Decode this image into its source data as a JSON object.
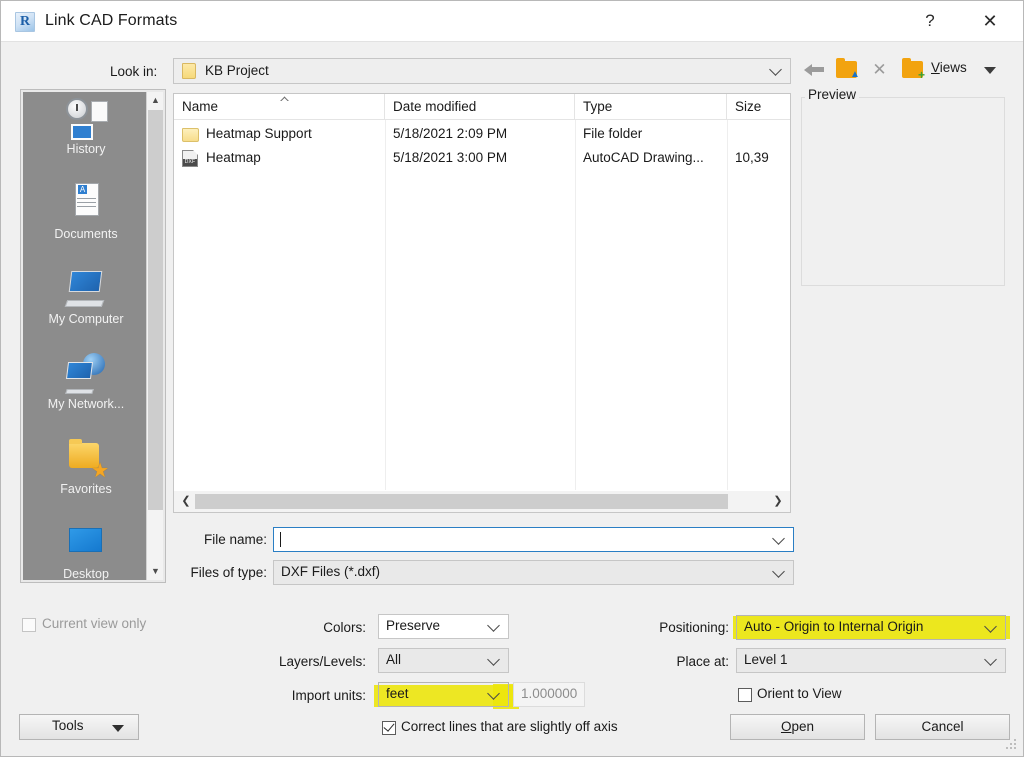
{
  "window": {
    "title": "Link CAD Formats",
    "app_icon": "revit-r-icon",
    "help_label": "?",
    "close_label": "✕"
  },
  "navigation": {
    "look_in_label": "Look in:",
    "look_in_value": "KB Project",
    "toolbar": {
      "back_icon": "back-arrow-icon",
      "up_folder_icon": "up-one-level-folder-icon",
      "delete_icon": "delete-x-icon",
      "new_folder_icon": "new-folder-icon",
      "views_label": "Views",
      "views_accel": "V"
    }
  },
  "places": [
    {
      "label": "History",
      "icon": "history-icon"
    },
    {
      "label": "Documents",
      "icon": "documents-icon"
    },
    {
      "label": "My Computer",
      "icon": "my-computer-icon"
    },
    {
      "label": "My Network...",
      "icon": "my-network-icon"
    },
    {
      "label": "Favorites",
      "icon": "favorites-icon"
    },
    {
      "label": "Desktop",
      "icon": "desktop-icon"
    }
  ],
  "file_list": {
    "columns": [
      "Name",
      "Date modified",
      "Type",
      "Size"
    ],
    "sort_column": "Name",
    "sort_direction": "ascending",
    "rows": [
      {
        "name": "Heatmap Support",
        "date_modified": "5/18/2021 2:09 PM",
        "type": "File folder",
        "size": "",
        "icon": "folder-icon"
      },
      {
        "name": "Heatmap",
        "date_modified": "5/18/2021 3:00 PM",
        "type": "AutoCAD Drawing...",
        "size": "10,39",
        "icon": "dxf-file-icon"
      }
    ]
  },
  "preview": {
    "label": "Preview"
  },
  "fields": {
    "file_name_label": "File name:",
    "file_name_value": "",
    "file_name_placeholder": "",
    "files_of_type_label": "Files of type:",
    "files_of_type_value": "DXF Files  (*.dxf)"
  },
  "options": {
    "current_view_only_label": "Current view only",
    "current_view_only_checked": false,
    "current_view_only_enabled": false,
    "colors_label": "Colors:",
    "colors_value": "Preserve",
    "layers_label": "Layers/Levels:",
    "layers_value": "All",
    "import_units_label": "Import units:",
    "import_units_value": "feet",
    "import_units_highlighted": true,
    "scale_value": "1.000000",
    "correct_lines_label": "Correct lines that are slightly off axis",
    "correct_lines_checked": true,
    "positioning_label": "Positioning:",
    "positioning_value": "Auto - Origin to Internal Origin",
    "positioning_highlighted": true,
    "place_at_label": "Place at:",
    "place_at_value": "Level 1",
    "orient_to_view_label": "Orient to View",
    "orient_to_view_checked": false
  },
  "buttons": {
    "tools_label": "Tools",
    "open_label": "Open",
    "open_accel": "O",
    "cancel_label": "Cancel"
  },
  "colors": {
    "highlight": "#ece60c",
    "accent_focus": "#2a7ec4",
    "dialog_bg": "#f0f0f0",
    "places_bg": "#8c8c8c"
  }
}
